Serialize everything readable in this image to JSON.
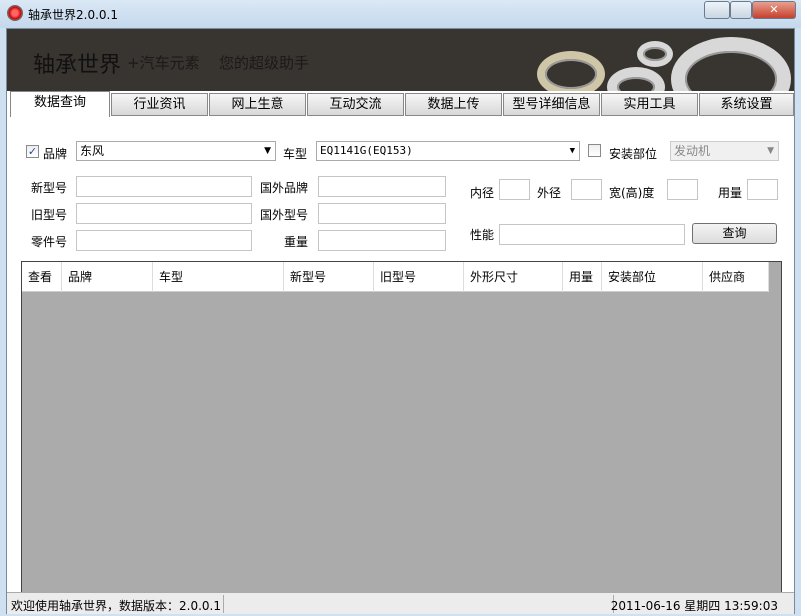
{
  "window": {
    "title": "轴承世界2.0.0.1"
  },
  "banner": {
    "name": "轴承世界",
    "tagline1": "+汽车元素",
    "tagline2": "您的超级助手"
  },
  "tabs": [
    {
      "label": "数据查询",
      "active": true
    },
    {
      "label": "行业资讯"
    },
    {
      "label": "网上生意"
    },
    {
      "label": "互动交流"
    },
    {
      "label": "数据上传"
    },
    {
      "label": "型号详细信息"
    },
    {
      "label": "实用工具"
    },
    {
      "label": "系统设置"
    }
  ],
  "form": {
    "brand": {
      "label": "品牌",
      "checked": true,
      "value": "东风"
    },
    "model": {
      "label": "车型",
      "value": "EQ1141G(EQ153)"
    },
    "position": {
      "label": "安装部位",
      "checked": false,
      "value": "发动机",
      "disabled": true
    },
    "new_model": {
      "label": "新型号",
      "value": ""
    },
    "old_model": {
      "label": "旧型号",
      "value": ""
    },
    "part_no": {
      "label": "零件号",
      "value": ""
    },
    "foreign_brand": {
      "label": "国外品牌",
      "value": ""
    },
    "foreign_model": {
      "label": "国外型号",
      "value": ""
    },
    "weight": {
      "label": "重量",
      "value": ""
    },
    "inner_d": {
      "label": "内径",
      "value": ""
    },
    "outer_d": {
      "label": "外径",
      "value": ""
    },
    "width": {
      "label": "宽(高)度",
      "value": ""
    },
    "usage": {
      "label": "用量",
      "value": ""
    },
    "performance": {
      "label": "性能",
      "value": ""
    },
    "query_button": "查询"
  },
  "grid": {
    "columns": [
      "查看",
      "品牌",
      "车型",
      "新型号",
      "旧型号",
      "外形尺寸",
      "用量",
      "安装部位",
      "供应商"
    ],
    "rows": []
  },
  "status": {
    "message": "欢迎使用轴承世界，数据版本：2.0.0.1",
    "datetime": "2011-06-16 星期四 13:59:03"
  }
}
